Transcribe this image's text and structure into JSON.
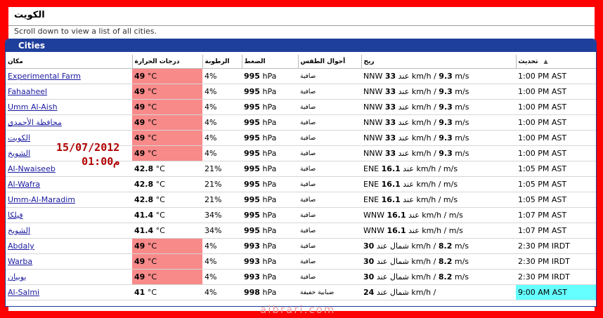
{
  "page": {
    "title": "الكويت",
    "hint": "Scroll down to view a list of all cities."
  },
  "panel": {
    "title": "Cities"
  },
  "columns": {
    "place": "مكان",
    "temperature": "درجات الحرارة",
    "humidity": "الرطوبة",
    "pressure": "الضغط",
    "conditions": "أحوال الطقس",
    "wind": "ريح",
    "updated": "تحديث"
  },
  "rows": [
    {
      "city": "Experimental Farm",
      "temp": "49",
      "temp_unit": "°C",
      "hot": true,
      "humidity": "4%",
      "pressure": "995",
      "pressure_unit": "hPa",
      "cond": "صافية",
      "wind_dir": "NNW",
      "wind_kmh": "33",
      "wind_mid": "عند km/h /",
      "wind_ms": "9.3",
      "wind_ms_unit": "m/s",
      "updated": "1:00 PM AST",
      "hl": false
    },
    {
      "city": "Fahaaheel",
      "temp": "49",
      "temp_unit": "°C",
      "hot": true,
      "humidity": "4%",
      "pressure": "995",
      "pressure_unit": "hPa",
      "cond": "صافية",
      "wind_dir": "NNW",
      "wind_kmh": "33",
      "wind_mid": "عند km/h /",
      "wind_ms": "9.3",
      "wind_ms_unit": "m/s",
      "updated": "1:00 PM AST",
      "hl": false
    },
    {
      "city": "Umm Al-Aish",
      "temp": "49",
      "temp_unit": "°C",
      "hot": true,
      "humidity": "4%",
      "pressure": "995",
      "pressure_unit": "hPa",
      "cond": "صافية",
      "wind_dir": "NNW",
      "wind_kmh": "33",
      "wind_mid": "عند km/h /",
      "wind_ms": "9.3",
      "wind_ms_unit": "m/s",
      "updated": "1:00 PM AST",
      "hl": false
    },
    {
      "city": "محافظة الأحمدي",
      "temp": "49",
      "temp_unit": "°C",
      "hot": true,
      "humidity": "4%",
      "pressure": "995",
      "pressure_unit": "hPa",
      "cond": "صافية",
      "wind_dir": "NNW",
      "wind_kmh": "33",
      "wind_mid": "عند km/h /",
      "wind_ms": "9.3",
      "wind_ms_unit": "m/s",
      "updated": "1:00 PM AST",
      "hl": false
    },
    {
      "city": "الكويت",
      "temp": "49",
      "temp_unit": "°C",
      "hot": true,
      "humidity": "4%",
      "pressure": "995",
      "pressure_unit": "hPa",
      "cond": "صافية",
      "wind_dir": "NNW",
      "wind_kmh": "33",
      "wind_mid": "عند km/h /",
      "wind_ms": "9.3",
      "wind_ms_unit": "m/s",
      "updated": "1:00 PM AST",
      "hl": false
    },
    {
      "city": "الشويخ",
      "temp": "49",
      "temp_unit": "°C",
      "hot": true,
      "humidity": "4%",
      "pressure": "995",
      "pressure_unit": "hPa",
      "cond": "صافية",
      "wind_dir": "NNW",
      "wind_kmh": "33",
      "wind_mid": "عند km/h /",
      "wind_ms": "9.3",
      "wind_ms_unit": "m/s",
      "updated": "1:00 PM AST",
      "hl": false
    },
    {
      "city": "Al-Nwaiseeb",
      "temp": "42.8",
      "temp_unit": "°C",
      "hot": false,
      "humidity": "21%",
      "pressure": "995",
      "pressure_unit": "hPa",
      "cond": "صافية",
      "wind_dir": "ENE",
      "wind_kmh": "16.1",
      "wind_mid": "عند km/h /",
      "wind_ms": "",
      "wind_ms_unit": "m/s",
      "updated": "1:05 PM AST",
      "hl": false
    },
    {
      "city": "Al-Wafra",
      "temp": "42.8",
      "temp_unit": "°C",
      "hot": false,
      "humidity": "21%",
      "pressure": "995",
      "pressure_unit": "hPa",
      "cond": "صافية",
      "wind_dir": "ENE",
      "wind_kmh": "16.1",
      "wind_mid": "عند km/h /",
      "wind_ms": "",
      "wind_ms_unit": "m/s",
      "updated": "1:05 PM AST",
      "hl": false
    },
    {
      "city": "Umm-Al-Maradim",
      "temp": "42.8",
      "temp_unit": "°C",
      "hot": false,
      "humidity": "21%",
      "pressure": "995",
      "pressure_unit": "hPa",
      "cond": "صافية",
      "wind_dir": "ENE",
      "wind_kmh": "16.1",
      "wind_mid": "عند km/h /",
      "wind_ms": "",
      "wind_ms_unit": "m/s",
      "updated": "1:05 PM AST",
      "hl": false
    },
    {
      "city": "فيلكا",
      "temp": "41.4",
      "temp_unit": "°C",
      "hot": false,
      "humidity": "34%",
      "pressure": "995",
      "pressure_unit": "hPa",
      "cond": "صافية",
      "wind_dir": "WNW",
      "wind_kmh": "16.1",
      "wind_mid": "عند km/h /",
      "wind_ms": "",
      "wind_ms_unit": "m/s",
      "updated": "1:07 PM AST",
      "hl": false
    },
    {
      "city": "الشويخ",
      "temp": "41.4",
      "temp_unit": "°C",
      "hot": false,
      "humidity": "34%",
      "pressure": "995",
      "pressure_unit": "hPa",
      "cond": "صافية",
      "wind_dir": "WNW",
      "wind_kmh": "16.1",
      "wind_mid": "عند km/h /",
      "wind_ms": "",
      "wind_ms_unit": "m/s",
      "updated": "1:07 PM AST",
      "hl": false
    },
    {
      "city": "Abdaly",
      "temp": "49",
      "temp_unit": "°C",
      "hot": true,
      "humidity": "4%",
      "pressure": "993",
      "pressure_unit": "hPa",
      "cond": "صافية",
      "wind_dir": "",
      "wind_kmh": "30",
      "wind_mid": "شمال عند km/h /",
      "wind_ms": "8.2",
      "wind_ms_unit": "m/s",
      "updated": "2:30 PM IRDT",
      "hl": false
    },
    {
      "city": "Warba",
      "temp": "49",
      "temp_unit": "°C",
      "hot": true,
      "humidity": "4%",
      "pressure": "993",
      "pressure_unit": "hPa",
      "cond": "صافية",
      "wind_dir": "",
      "wind_kmh": "30",
      "wind_mid": "شمال عند km/h /",
      "wind_ms": "8.2",
      "wind_ms_unit": "m/s",
      "updated": "2:30 PM IRDT",
      "hl": false
    },
    {
      "city": "بوبيان",
      "temp": "49",
      "temp_unit": "°C",
      "hot": true,
      "humidity": "4%",
      "pressure": "993",
      "pressure_unit": "hPa",
      "cond": "صافية",
      "wind_dir": "",
      "wind_kmh": "30",
      "wind_mid": "شمال عند km/h /",
      "wind_ms": "8.2",
      "wind_ms_unit": "m/s",
      "updated": "2:30 PM IRDT",
      "hl": false
    },
    {
      "city": "Al-Salmi",
      "temp": "41",
      "temp_unit": "°C",
      "hot": false,
      "humidity": "4%",
      "pressure": "998",
      "pressure_unit": "hPa",
      "cond": "ضبابية خفيفة",
      "wind_dir": "",
      "wind_kmh": "24",
      "wind_mid": "شمال عند km/h /",
      "wind_ms": "",
      "wind_ms_unit": "",
      "updated": "9:00 AM AST",
      "hl": true
    }
  ],
  "overlay": {
    "date": "15/07/2012",
    "time": "01:00م"
  },
  "watermark": "albrari.com",
  "icons": {
    "sort": "sort-ascending-icon"
  },
  "colors": {
    "frame": "#ff0000",
    "header_bar": "#1f3f9c",
    "hot_cell": "#f88a8a",
    "highlight": "#66ffff",
    "link": "#1a1aa0"
  }
}
